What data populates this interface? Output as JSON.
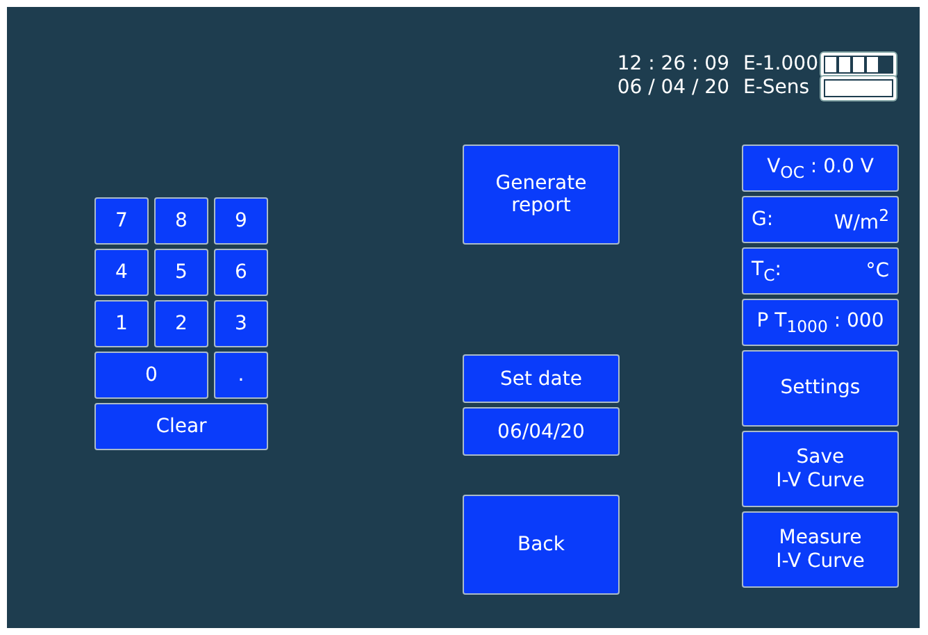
{
  "status": {
    "time": "12 : 26 : 09",
    "date": "06 / 04 / 20",
    "meters": [
      {
        "label": "E-1.000",
        "level": 0.8
      },
      {
        "label": "E-Sens",
        "level": 1
      }
    ]
  },
  "keypad": [
    {
      "label": "7",
      "kind": "key"
    },
    {
      "label": "8",
      "kind": "key"
    },
    {
      "label": "9",
      "kind": "key"
    },
    {
      "label": "4",
      "kind": "key"
    },
    {
      "label": "5",
      "kind": "key"
    },
    {
      "label": "6",
      "kind": "key"
    },
    {
      "label": "1",
      "kind": "key"
    },
    {
      "label": "2",
      "kind": "key"
    },
    {
      "label": "3",
      "kind": "key"
    },
    {
      "label": "0",
      "kind": "wide"
    },
    {
      "label": ".",
      "kind": "key"
    },
    {
      "label": "Clear",
      "kind": "full"
    }
  ],
  "middle": [
    {
      "label": "Generate report",
      "kind": "tall"
    },
    {
      "label": "Set date",
      "kind": "first"
    },
    {
      "label": "06/04/20",
      "kind": "field"
    },
    {
      "label": "Back",
      "kind": "tall"
    }
  ],
  "readings": [
    {
      "kind": "centered",
      "label": "V$_{OC}$ : 0.0 V"
    },
    {
      "kind": "split",
      "label": "G:",
      "unit": "W/m$^{2}$"
    },
    {
      "kind": "split",
      "label": "T$_{C}$:",
      "unit": "°C"
    },
    {
      "kind": "centered",
      "label": "P T$_{1000}$ : 000"
    }
  ],
  "actions": [
    "Settings",
    "Save\nI-V Curve",
    "Measure\nI-V Curve"
  ]
}
